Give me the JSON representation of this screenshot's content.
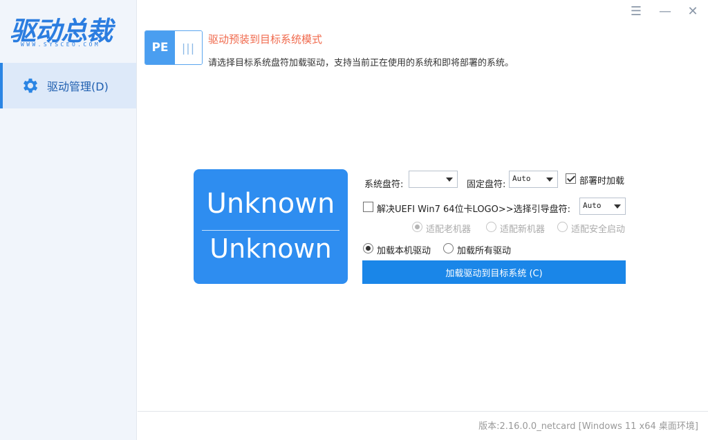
{
  "app": {
    "logo_text": "驱动总裁",
    "logo_url": "WWW.SYSCEO.COM"
  },
  "sidebar": {
    "items": [
      {
        "label": "驱动管理(D)",
        "icon": "gear-icon",
        "selected": true
      }
    ]
  },
  "window": {
    "menu_icon": "☰",
    "minimize_icon": "—",
    "close_icon": "✕"
  },
  "mode": {
    "toggle_left": "PE",
    "toggle_right": "|||",
    "title": "驱动预装到目标系统模式",
    "description": "请选择目标系统盘符加载驱动，支持当前正在使用的系统和即将部署的系统。"
  },
  "tile": {
    "line1": "Unknown",
    "line2": "Unknown"
  },
  "form": {
    "system_drive_label": "系统盘符:",
    "system_drive_value": "",
    "fixed_drive_label": "固定盘符:",
    "fixed_drive_value": "Auto",
    "load_on_deploy_label": "部署时加载",
    "load_on_deploy_checked": true,
    "uefi_fix_label": "解决UEFI Win7 64位卡LOGO>>选择引导盘符:",
    "uefi_fix_checked": false,
    "boot_drive_value": "Auto",
    "radio_old_machine": "适配老机器",
    "radio_new_machine": "适配新机器",
    "radio_secure_boot": "适配安全启动",
    "radio_load_local": "加载本机驱动",
    "radio_load_all": "加载所有驱动",
    "load_button": "加载驱动到目标系统 (C)"
  },
  "footer": {
    "version": "版本:2.16.0.0_netcard [Windows 11 x64 桌面环境]"
  },
  "colors": {
    "accent": "#1a86e8",
    "tile": "#2e8df0",
    "title_red": "#f06a4d",
    "sidebar_bg": "#f1f5fb"
  }
}
